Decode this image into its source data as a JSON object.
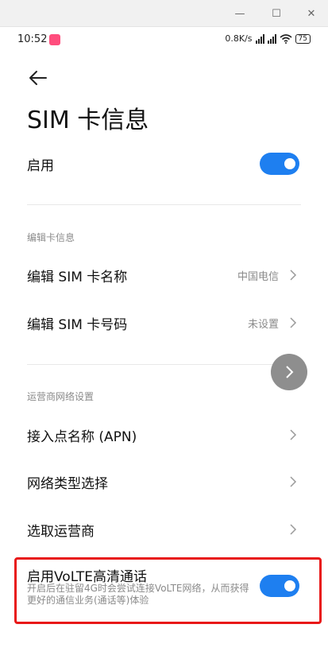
{
  "window": {
    "min": "—",
    "max": "☐",
    "close": "✕"
  },
  "status": {
    "time": "10:52",
    "speed": "0.8K/s",
    "battery": "75"
  },
  "header": {
    "title": "SIM 卡信息"
  },
  "enable": {
    "label": "启用",
    "on": true
  },
  "edit_section": {
    "title": "编辑卡信息"
  },
  "edit_name": {
    "label": "编辑 SIM 卡名称",
    "value": "中国电信"
  },
  "edit_number": {
    "label": "编辑 SIM 卡号码",
    "value": "未设置"
  },
  "carrier_section": {
    "title": "运营商网络设置"
  },
  "apn": {
    "label": "接入点名称 (APN)"
  },
  "network_type": {
    "label": "网络类型选择"
  },
  "carrier_select": {
    "label": "选取运营商"
  },
  "volte": {
    "label": "启用VoLTE高清通话",
    "description": "开启后在驻留4G时会尝试连接VoLTE网络，从而获得更好的通信业务(通话等)体验",
    "on": true
  },
  "colors": {
    "accent": "#1e7ff0",
    "highlight": "#e81818"
  }
}
